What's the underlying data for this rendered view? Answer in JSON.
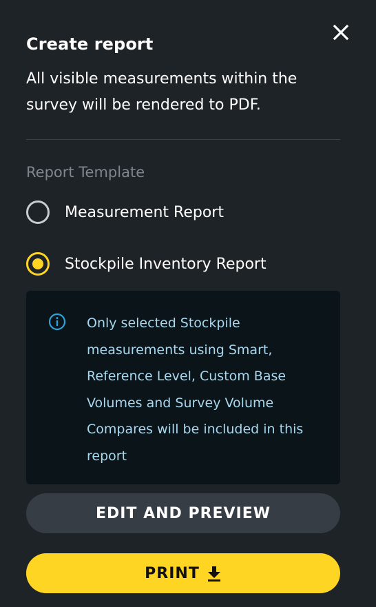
{
  "dialog": {
    "title": "Create report",
    "description": "All visible measurements within the survey will be rendered to PDF.",
    "close_icon": "close-icon"
  },
  "template": {
    "section_label": "Report Template",
    "options": [
      {
        "label": "Measurement Report",
        "selected": false
      },
      {
        "label": "Stockpile Inventory Report",
        "selected": true
      }
    ]
  },
  "info": {
    "icon": "info-icon",
    "text": "Only selected Stockpile measurements using Smart, Reference Level, Custom Base Volumes and Survey Volume Compares will be included in this report"
  },
  "actions": {
    "edit_label": "EDIT AND PREVIEW",
    "print_label": "PRINT",
    "print_icon": "download-icon"
  },
  "colors": {
    "background": "#1e2328",
    "accent": "#ffd523",
    "info_background": "#0b1419",
    "info_text": "#a8d8ef",
    "info_icon": "#2ea3d9"
  }
}
